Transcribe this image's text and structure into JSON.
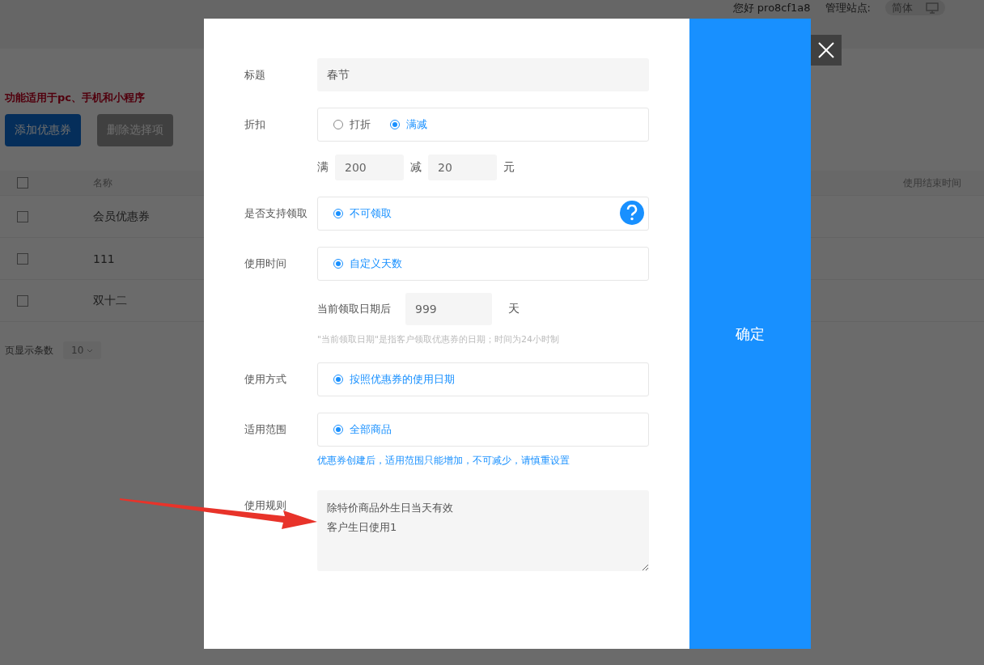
{
  "header": {
    "greeting": "您好 pro8cf1a8",
    "site_label": "管理站点:",
    "language": "简体"
  },
  "notice": "功能适用于pc、手机和小程序",
  "toolbar": [
    {
      "label": "添加优惠券",
      "kind": "primary"
    },
    {
      "label": "删除选择项",
      "kind": "secondary"
    }
  ],
  "table": {
    "header_checked": false,
    "columns": [
      "名称",
      "使用结束时间"
    ],
    "rows": [
      {
        "name": "会员优惠券",
        "checked": false
      },
      {
        "name": "111",
        "checked": false
      },
      {
        "name": "双十二",
        "checked": false
      }
    ]
  },
  "pagination": {
    "label": "页显示条数",
    "page_size": "10"
  },
  "dialog": {
    "confirm": "确定",
    "fields": [
      {
        "kind": "text",
        "label": "标题",
        "value": "春节"
      },
      {
        "kind": "radio",
        "label": "折扣",
        "options": [
          {
            "label": "打折",
            "selected": false
          },
          {
            "label": "满减",
            "selected": true
          }
        ]
      },
      {
        "kind": "amount",
        "full_label": "满",
        "full": "200",
        "minus_label": "减",
        "minus": "20",
        "unit": "元"
      },
      {
        "kind": "radio",
        "label": "是否支持领取",
        "help": true,
        "options": [
          {
            "label": "不可领取",
            "selected": true
          }
        ]
      },
      {
        "kind": "radio",
        "label": "使用时间",
        "options": [
          {
            "label": "自定义天数",
            "selected": true
          }
        ]
      },
      {
        "kind": "days",
        "label": "当前领取日期后",
        "value": "999",
        "unit": "天",
        "hint": "\"当前领取日期\"是指客户领取优惠券的日期；时间为24小时制"
      },
      {
        "kind": "radio",
        "label": "使用方式",
        "options": [
          {
            "label": "按照优惠券的使用日期",
            "selected": true
          }
        ]
      },
      {
        "kind": "radio",
        "label": "适用范围",
        "note": "优惠券创建后，适用范围只能增加，不可减少，请慎重设置",
        "options": [
          {
            "label": "全部商品",
            "selected": true
          }
        ]
      },
      {
        "kind": "textarea",
        "label": "使用规则",
        "lines": [
          "除特价商品外生日当天有效",
          "客户生日使用1"
        ]
      }
    ]
  }
}
